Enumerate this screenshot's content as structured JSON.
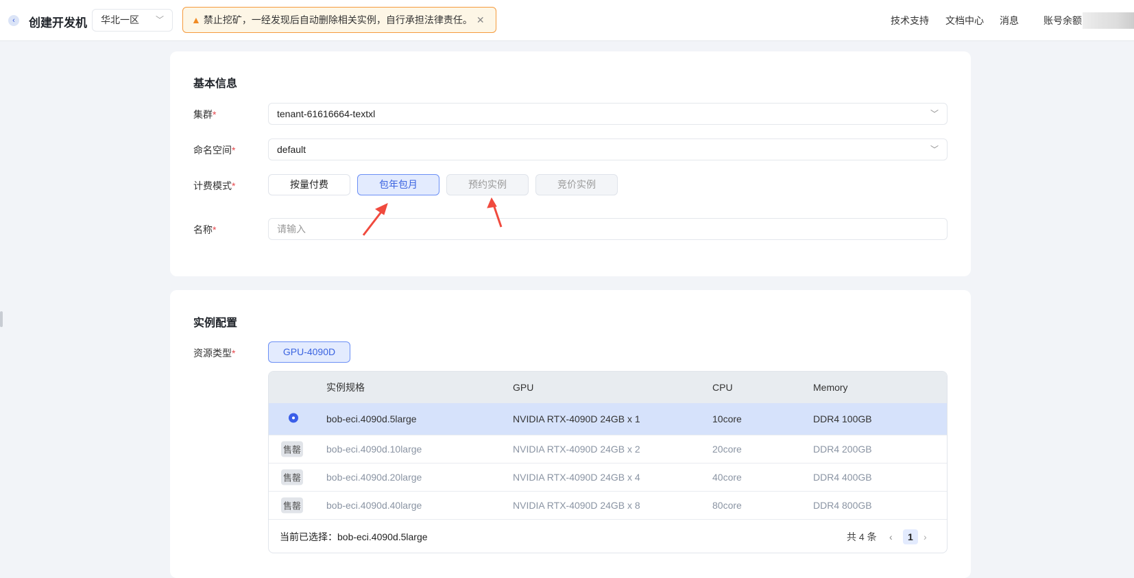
{
  "header": {
    "back_icon": "chevron-left-icon",
    "title": "创建开发机",
    "region": "华北一区",
    "alert": "禁止挖矿，一经发现后自动删除相关实例，自行承担法律责任。",
    "nav": [
      "技术支持",
      "文档中心",
      "消息",
      "账号余额"
    ]
  },
  "basic": {
    "title": "基本信息",
    "cluster_label": "集群",
    "cluster_value": "tenant-61616664-textxl",
    "ns_label": "命名空间",
    "ns_value": "default",
    "billing_label": "计费模式",
    "billing_options": [
      "按量付费",
      "包年包月",
      "预约实例",
      "竞价实例"
    ],
    "billing_selected": "包年包月",
    "name_label": "名称",
    "name_placeholder": "请输入",
    "required_mark": "*"
  },
  "instance": {
    "title": "实例配置",
    "resource_label": "资源类型",
    "resource_type": "GPU-4090D",
    "columns": [
      "实例规格",
      "GPU",
      "CPU",
      "Memory"
    ],
    "rows": [
      {
        "status": "selected",
        "spec": "bob-eci.4090d.5large",
        "gpu": "NVIDIA RTX-4090D 24GB x 1",
        "cpu": "10core",
        "mem": "DDR4 100GB"
      },
      {
        "status": "售罄",
        "spec": "bob-eci.4090d.10large",
        "gpu": "NVIDIA RTX-4090D 24GB x 2",
        "cpu": "20core",
        "mem": "DDR4 200GB"
      },
      {
        "status": "售罄",
        "spec": "bob-eci.4090d.20large",
        "gpu": "NVIDIA RTX-4090D 24GB x 4",
        "cpu": "40core",
        "mem": "DDR4 400GB"
      },
      {
        "status": "售罄",
        "spec": "bob-eci.4090d.40large",
        "gpu": "NVIDIA RTX-4090D 24GB x 8",
        "cpu": "80core",
        "mem": "DDR4 800GB"
      }
    ],
    "selected_text": "当前已选择：bob-eci.4090d.5large",
    "total": "共 4 条",
    "page": "1"
  },
  "colors": {
    "accent": "#3a63e0",
    "annotation_arrow": "#f04a3e"
  }
}
